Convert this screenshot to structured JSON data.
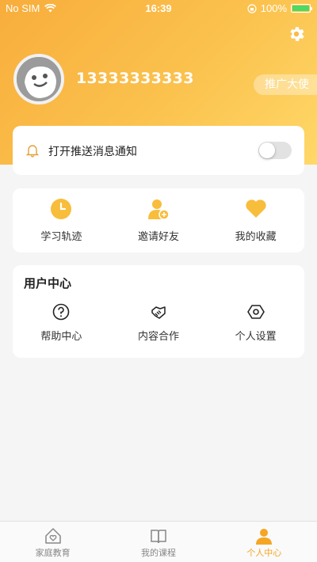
{
  "status_bar": {
    "carrier": "No SIM",
    "time": "16:39",
    "battery": "100%"
  },
  "profile": {
    "phone": "13333333333",
    "ambassador_label": "推广大使"
  },
  "notification": {
    "label": "打开推送消息通知",
    "enabled": false
  },
  "quick_actions": [
    {
      "label": "学习轨迹",
      "icon": "clock-icon"
    },
    {
      "label": "邀请好友",
      "icon": "add-user-icon"
    },
    {
      "label": "我的收藏",
      "icon": "heart-icon"
    }
  ],
  "user_center": {
    "title": "用户中心",
    "items": [
      {
        "label": "帮助中心",
        "icon": "question-icon"
      },
      {
        "label": "内容合作",
        "icon": "handshake-icon"
      },
      {
        "label": "个人设置",
        "icon": "hexagon-settings-icon"
      }
    ]
  },
  "tabs": [
    {
      "label": "家庭教育",
      "icon": "home-heart-icon",
      "active": false
    },
    {
      "label": "我的课程",
      "icon": "book-icon",
      "active": false
    },
    {
      "label": "个人中心",
      "icon": "person-icon",
      "active": true
    }
  ],
  "colors": {
    "accent": "#f5a623",
    "hero_start": "#f8ad3b",
    "hero_end": "#ffd868"
  }
}
